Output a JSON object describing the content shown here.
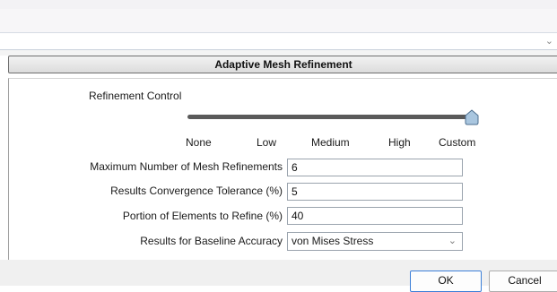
{
  "dialog": {
    "title": "Adaptive Mesh Refinement",
    "section_label": "Refinement Control",
    "slider": {
      "ticks": [
        "None",
        "Low",
        "Medium",
        "High",
        "Custom"
      ],
      "selected": "Custom"
    },
    "fields": [
      {
        "label": "Maximum Number of Mesh Refinements",
        "value": "6"
      },
      {
        "label": "Results Convergence Tolerance (%)",
        "value": "5"
      },
      {
        "label": "Portion of Elements to Refine (%)",
        "value": "40"
      }
    ],
    "baseline": {
      "label": "Results for Baseline Accuracy",
      "value": "von Mises Stress"
    },
    "buttons": {
      "ok": "OK",
      "cancel": "Cancel"
    }
  },
  "icons": {
    "dropdown": "chevron-down-icon",
    "slider_thumb": "slider-thumb-icon"
  },
  "colors": {
    "ok_border": "#3c7fd8",
    "slider_thumb": "#a9c6df",
    "track": "#5a5a5a"
  }
}
